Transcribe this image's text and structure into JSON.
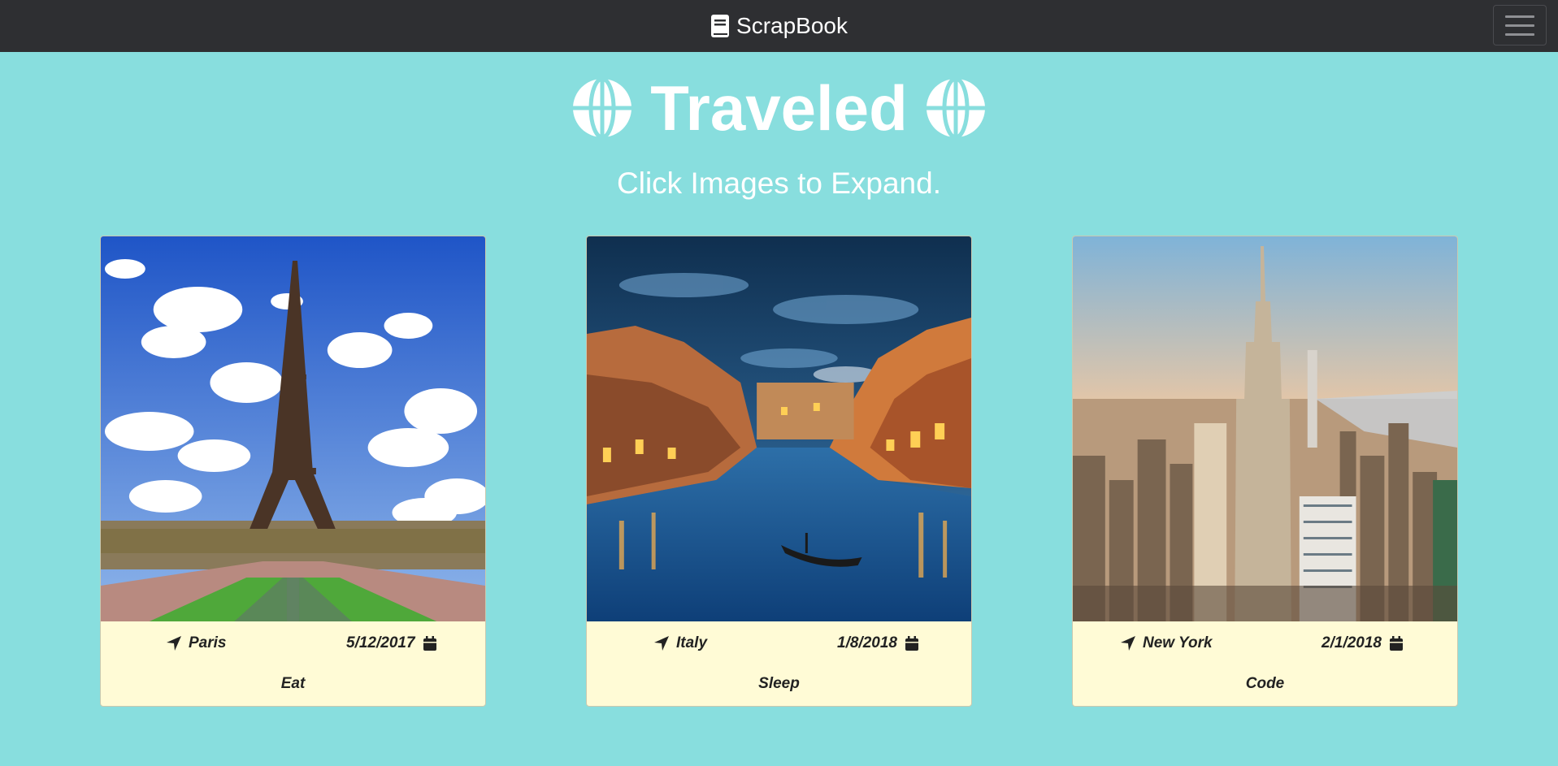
{
  "navbar": {
    "brand": "ScrapBook",
    "book_icon": "book-icon",
    "menu_icon": "hamburger-menu-icon"
  },
  "header": {
    "title": "Traveled",
    "globe_icon": "globe-icon",
    "subtitle": "Click Images to Expand."
  },
  "cards": [
    {
      "location": "Paris",
      "date": "5/12/2017",
      "caption": "Eat"
    },
    {
      "location": "Italy",
      "date": "1/8/2018",
      "caption": "Sleep"
    },
    {
      "location": "New York",
      "date": "2/1/2018",
      "caption": "Code"
    }
  ],
  "colors": {
    "background": "#88dede",
    "navbar": "#2e2f32",
    "card": "#fffbd6",
    "text": "#222222"
  }
}
